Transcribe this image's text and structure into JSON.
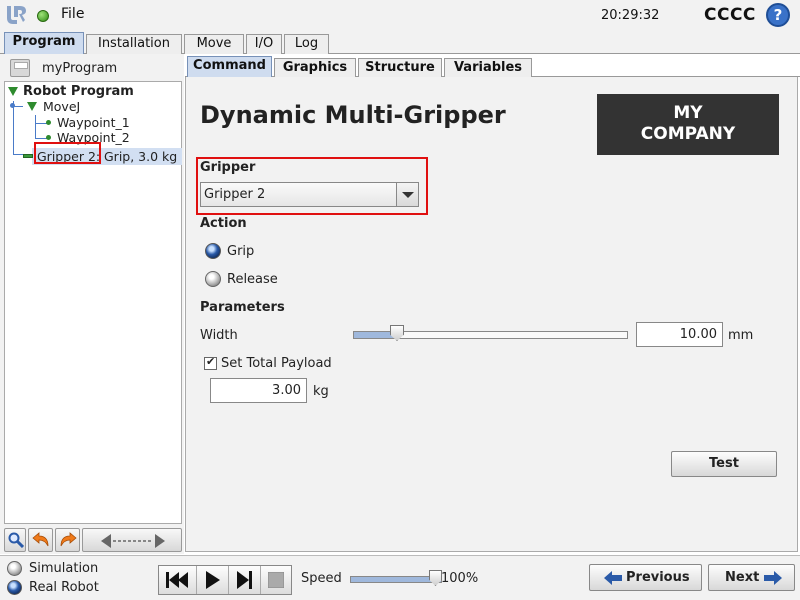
{
  "topbar": {
    "logo_icon": "universal-robots-logo",
    "menu_label": "File",
    "time": "20:29:32",
    "robot_name": "CCCC",
    "help_label": "?"
  },
  "main_tabs": [
    {
      "label": "Program",
      "active": true
    },
    {
      "label": "Installation",
      "active": false
    },
    {
      "label": "Move",
      "active": false
    },
    {
      "label": "I/O",
      "active": false
    },
    {
      "label": "Log",
      "active": false
    }
  ],
  "program": {
    "name": "myProgram",
    "tree": {
      "root": "Robot Program",
      "movej": "MoveJ",
      "waypoint_1": "Waypoint_1",
      "waypoint_2": "Waypoint_2",
      "gripper_name": "Gripper 2:",
      "gripper_summary": "Grip, 3.0 kg"
    }
  },
  "left_toolbar": {
    "icons": [
      "search-icon",
      "undo-icon",
      "redo-icon",
      "move-arrows-icon"
    ]
  },
  "content_tabs": [
    {
      "label": "Command",
      "active": true
    },
    {
      "label": "Graphics",
      "active": false
    },
    {
      "label": "Structure",
      "active": false
    },
    {
      "label": "Variables",
      "active": false
    }
  ],
  "command": {
    "title": "Dynamic Multi-Gripper",
    "company_logo_line1": "MY",
    "company_logo_line2": "COMPANY",
    "gripper_label": "Gripper",
    "gripper_selected": "Gripper 2",
    "action_label": "Action",
    "action_options": [
      {
        "label": "Grip",
        "selected": true
      },
      {
        "label": "Release",
        "selected": false
      }
    ],
    "parameters_label": "Parameters",
    "width_label": "Width",
    "width_value": "10.00",
    "width_unit": "mm",
    "width_slider_fraction": 0.16,
    "set_payload_label": "Set Total Payload",
    "set_payload_checked": true,
    "payload_value": "3.00",
    "payload_unit": "kg",
    "test_label": "Test"
  },
  "bottom": {
    "mode_simulation": "Simulation",
    "mode_real_robot": "Real Robot",
    "speed_label": "Speed",
    "speed_value": "100%",
    "speed_fraction": 1.0,
    "previous_label": "Previous",
    "next_label": "Next"
  },
  "colors": {
    "active_tab": "#cfdcef",
    "highlight_box": "#e01010",
    "accent_blue": "#2a5aa8",
    "tree_green": "#2e8b2e"
  }
}
